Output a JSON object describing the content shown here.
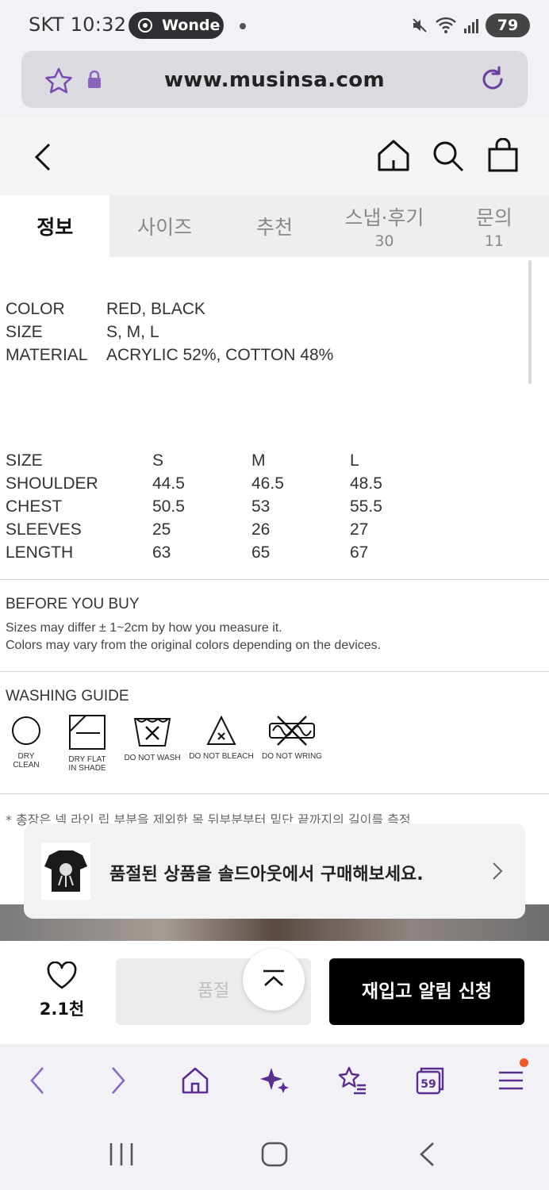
{
  "status_bar": {
    "carrier_time": "SKT 10:32",
    "pill_text": "Wonde",
    "battery": "79"
  },
  "browser": {
    "url": "www.musinsa.com"
  },
  "tabs": [
    {
      "label": "정보",
      "count": ""
    },
    {
      "label": "사이즈",
      "count": ""
    },
    {
      "label": "추천",
      "count": ""
    },
    {
      "label": "스냅·후기",
      "count": "30"
    },
    {
      "label": "문의",
      "count": "11"
    }
  ],
  "spec": [
    {
      "key": "COLOR",
      "value": "RED, BLACK"
    },
    {
      "key": "SIZE",
      "value": "S, M, L"
    },
    {
      "key": "MATERIAL",
      "value": "ACRYLIC 52%, COTTON 48%"
    }
  ],
  "size_table": {
    "header": [
      "SIZE",
      "S",
      "M",
      "L"
    ],
    "rows": [
      [
        "SHOULDER",
        "44.5",
        "46.5",
        "48.5"
      ],
      [
        "CHEST",
        "50.5",
        "53",
        "55.5"
      ],
      [
        "SLEEVES",
        "25",
        "26",
        "27"
      ],
      [
        "LENGTH",
        "63",
        "65",
        "67"
      ]
    ]
  },
  "before_you_buy": {
    "title": "BEFORE YOU BUY",
    "lines": [
      "Sizes may differ ± 1~2cm by how you measure it.",
      "Colors may vary from the original colors depending on the devices."
    ]
  },
  "washing_guide": {
    "title": "WASHING GUIDE",
    "items": [
      {
        "icon": "dry-clean-icon",
        "label": "DRY CLEAN",
        "label2": ""
      },
      {
        "icon": "dry-flat-icon",
        "label": "DRY FLAT",
        "label2": "IN SHADE"
      },
      {
        "icon": "do-not-wash-icon",
        "label": "DO NOT WASH",
        "label2": ""
      },
      {
        "icon": "do-not-bleach-icon",
        "label": "DO NOT BLEACH",
        "label2": ""
      },
      {
        "icon": "do-not-wring-icon",
        "label": "DO NOT WRING",
        "label2": ""
      }
    ]
  },
  "measure_note": "* 총장은 넥 라인 립 부분을 제외한 목 뒤부분부터 밑단 끝까지의 길이를 측정",
  "soldout_banner": {
    "text": "품절된 상품을 솔드아웃에서 구매해보세요."
  },
  "buy_bar": {
    "like_count": "2.1천",
    "soldout_label": "품절",
    "restock_label": "재입고 알림 신청"
  },
  "bottom_toolbar": {
    "tabs_count": "59"
  },
  "colors": {
    "accent_purple": "#6b3fa0",
    "button_black": "#000000",
    "badge_orange": "#f05a28"
  }
}
